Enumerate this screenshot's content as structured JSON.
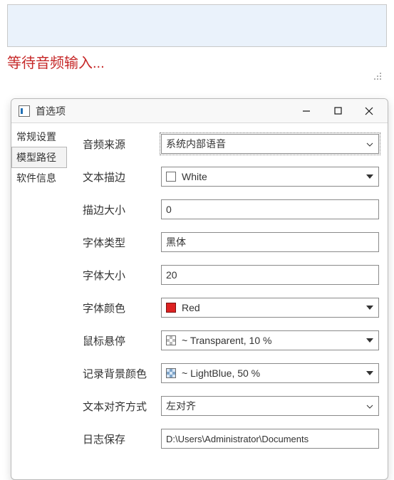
{
  "banner": {
    "waiting_text": "等待音频输入..."
  },
  "window": {
    "title": "首选项",
    "tabs": [
      {
        "label": "常规设置"
      },
      {
        "label": "模型路径"
      },
      {
        "label": "软件信息"
      }
    ]
  },
  "form": {
    "audio_source": {
      "label": "音频来源",
      "value": "系统内部语音"
    },
    "text_stroke": {
      "label": "文本描边",
      "value": "White",
      "swatch": "white"
    },
    "stroke_size": {
      "label": "描边大小",
      "value": "0"
    },
    "font_family": {
      "label": "字体类型",
      "value": "黑体"
    },
    "font_size": {
      "label": "字体大小",
      "value": "20"
    },
    "font_color": {
      "label": "字体颜色",
      "value": "Red",
      "swatch": "red"
    },
    "hover_bg": {
      "label": "鼠标悬停",
      "value": "~ Transparent, 10 %",
      "swatch": "checker"
    },
    "record_bg": {
      "label": "记录背景颜色",
      "value": "~ LightBlue, 50 %",
      "swatch": "lightblue"
    },
    "text_align": {
      "label": "文本对齐方式",
      "value": "左对齐"
    },
    "log_path": {
      "label": "日志保存",
      "value": "D:\\Users\\Administrator\\Documents"
    }
  }
}
